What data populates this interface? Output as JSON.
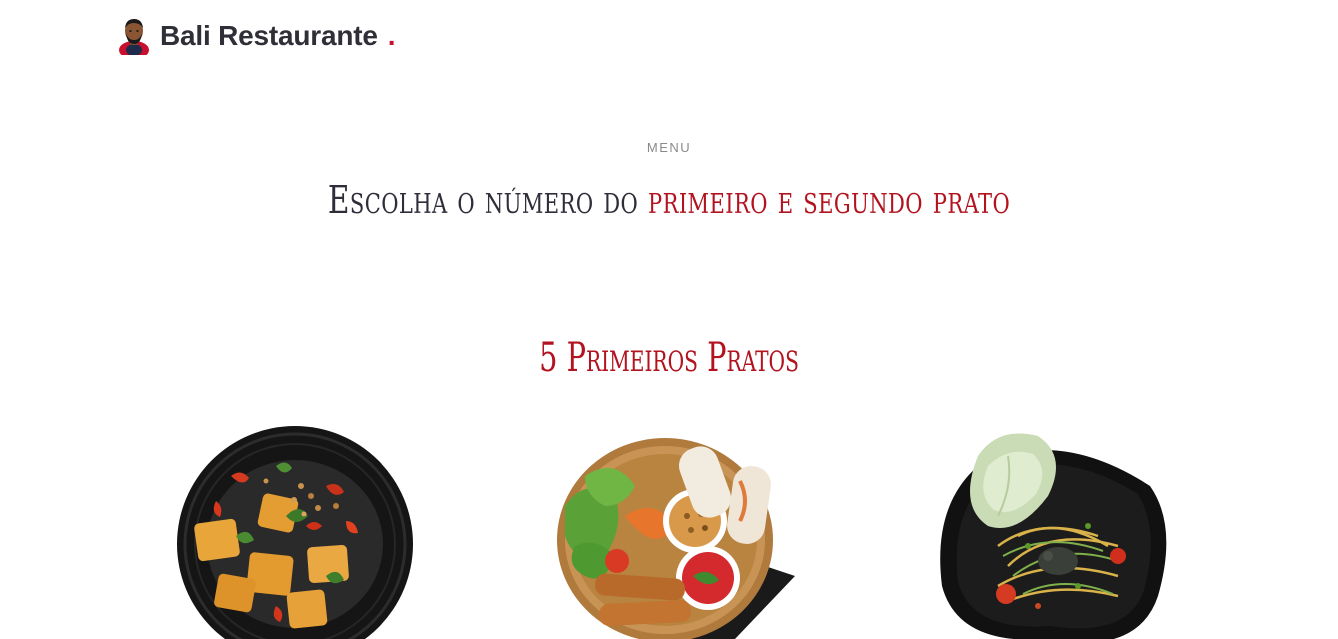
{
  "header": {
    "brand_name": "Bali Restaurante",
    "brand_dot": "."
  },
  "menu_section": {
    "eyebrow": "MENU",
    "headline_part1": "Escolha o número do ",
    "headline_part2": "primeiro e segundo prato",
    "subheading": "5 Primeiros Pratos"
  },
  "colors": {
    "accent": "#b2131f",
    "text_dark": "#2e2e3a",
    "muted": "#8a8a8a"
  },
  "dishes": [
    {
      "icon": "tofu-bowl-image"
    },
    {
      "icon": "spring-roll-basket-image"
    },
    {
      "icon": "papaya-salad-plate-image"
    }
  ]
}
